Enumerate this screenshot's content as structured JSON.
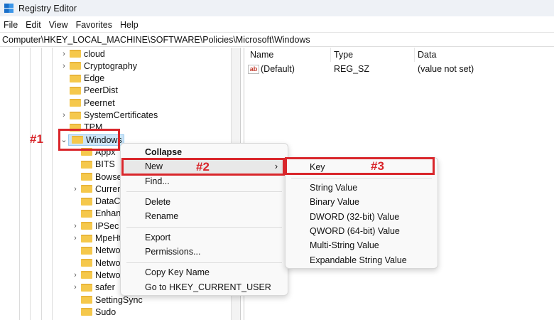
{
  "window": {
    "title": "Registry Editor"
  },
  "menubar": [
    "File",
    "Edit",
    "View",
    "Favorites",
    "Help"
  ],
  "address": "Computer\\HKEY_LOCAL_MACHINE\\SOFTWARE\\Policies\\Microsoft\\Windows",
  "tree": [
    {
      "label": "cloud",
      "expandable": true
    },
    {
      "label": "Cryptography",
      "expandable": true
    },
    {
      "label": "Edge",
      "expandable": false
    },
    {
      "label": "PeerDist",
      "expandable": false
    },
    {
      "label": "Peernet",
      "expandable": false
    },
    {
      "label": "SystemCertificates",
      "expandable": true
    },
    {
      "label": "TPM",
      "expandable": false
    },
    {
      "label": "Windows",
      "expanded": true,
      "selected": true
    },
    {
      "label": "Appx",
      "child": true
    },
    {
      "label": "BITS",
      "child": true
    },
    {
      "label": "Bowser",
      "child": true
    },
    {
      "label": "Current",
      "child": true,
      "expandable": true
    },
    {
      "label": "DataCo",
      "child": true
    },
    {
      "label": "Enhanc",
      "child": true
    },
    {
      "label": "IPSec",
      "child": true,
      "expandable": true
    },
    {
      "label": "MpeHt",
      "child": true,
      "expandable": true
    },
    {
      "label": "Netwo",
      "child": true
    },
    {
      "label": "Netwo",
      "child": true
    },
    {
      "label": "Netwo",
      "child": true,
      "expandable": true
    },
    {
      "label": "safer",
      "child": true,
      "expandable": true
    },
    {
      "label": "SettingSync",
      "child": true
    },
    {
      "label": "Sudo",
      "child": true
    }
  ],
  "values": {
    "columns": [
      "Name",
      "Type",
      "Data"
    ],
    "rows": [
      {
        "name": "(Default)",
        "type": "REG_SZ",
        "data": "(value not set)"
      }
    ]
  },
  "context_menu": {
    "items": [
      "Collapse",
      "New",
      "Find...",
      "Delete",
      "Rename",
      "Export",
      "Permissions...",
      "Copy Key Name",
      "Go to HKEY_CURRENT_USER"
    ]
  },
  "submenu": {
    "items": [
      "Key",
      "String Value",
      "Binary Value",
      "DWORD (32-bit) Value",
      "QWORD (64-bit) Value",
      "Multi-String Value",
      "Expandable String Value"
    ]
  },
  "annotations": [
    "#1",
    "#2",
    "#3"
  ],
  "colors": {
    "annotation": "#d9262b",
    "selection": "#cce4f7"
  }
}
